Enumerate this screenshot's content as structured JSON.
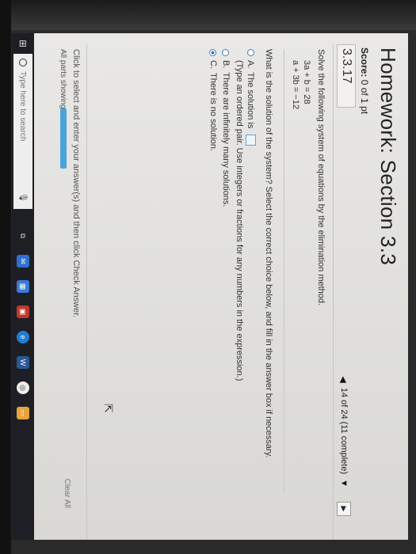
{
  "header": {
    "title": "Homework: Section 3.3",
    "score_label": "Score:",
    "score_value": "0 of 1 pt",
    "question_id": "3.3.17"
  },
  "progress": {
    "text": "14 of 24 (11 complete)"
  },
  "question": {
    "prompt": "Solve the following system of equations by the elimination method.",
    "equation_1": "3a + b = 28",
    "equation_2": "a + 3b = −12",
    "instruction": "What is the solution of the system? Select the correct choice below, and fill in the answer box if necessary.",
    "options": [
      {
        "letter": "A.",
        "text": "The solution is",
        "selected": false
      },
      {
        "letter": "B.",
        "text": "There are infinitely many solutions.",
        "selected": false
      },
      {
        "letter": "C.",
        "text": "There is no solution.",
        "selected": true
      }
    ],
    "option_a_hint": "(Type an ordered pair. Use integers or fractions for any numbers in the expression.)"
  },
  "footer": {
    "instruction": "Click to select and enter your answer(s) and then click Check Answer.",
    "parts_label": "All parts showing",
    "parts_progress": 1.0,
    "clear_all": "Clear All"
  },
  "taskbar": {
    "search_placeholder": "Type here to search",
    "icons": [
      "task-view-icon",
      "mail-icon",
      "store-icon",
      "photos-icon",
      "edge-icon",
      "word-icon",
      "chrome-icon",
      "files-icon"
    ]
  },
  "colors": {
    "accent": "#2b6cb0",
    "progress_bar": "#4aa3d9",
    "taskbar": "#1e1f24"
  }
}
